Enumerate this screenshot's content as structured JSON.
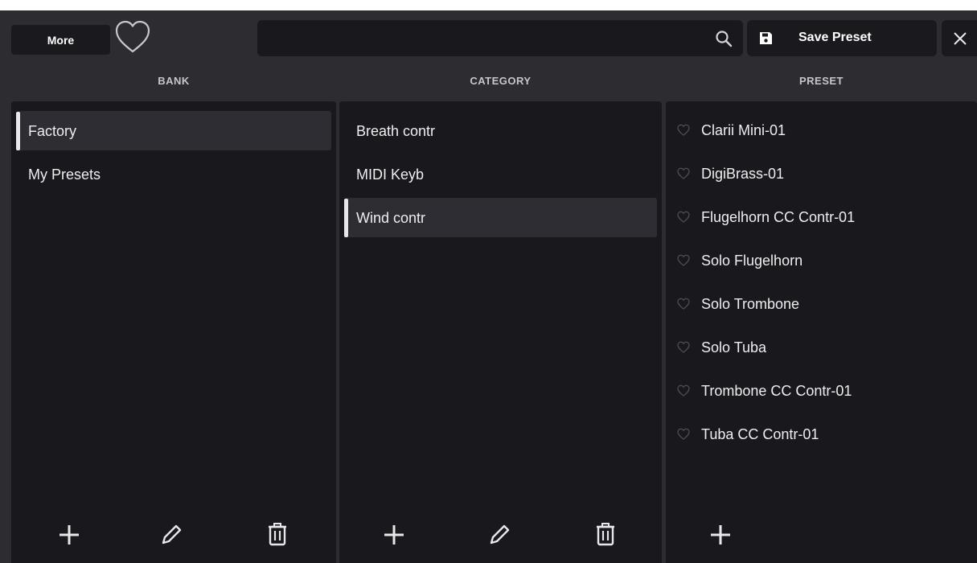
{
  "topbar": {
    "more_label": "More",
    "search_value": "",
    "search_placeholder": "",
    "save_label": "Save Preset"
  },
  "headers": {
    "bank": "BANK",
    "category": "CATEGORY",
    "preset": "PRESET"
  },
  "bank": {
    "items": [
      {
        "label": "Factory",
        "selected": true
      },
      {
        "label": "My Presets",
        "selected": false
      }
    ]
  },
  "category": {
    "items": [
      {
        "label": "Breath contr",
        "selected": false
      },
      {
        "label": "MIDI Keyb",
        "selected": false
      },
      {
        "label": "Wind contr",
        "selected": true
      }
    ]
  },
  "preset": {
    "items": [
      {
        "label": "Clarii Mini-01"
      },
      {
        "label": "DigiBrass-01"
      },
      {
        "label": "Flugelhorn CC Contr-01"
      },
      {
        "label": "Solo Flugelhorn"
      },
      {
        "label": "Solo Trombone"
      },
      {
        "label": "Solo Tuba"
      },
      {
        "label": "Trombone CC Contr-01"
      },
      {
        "label": "Tuba CC Contr-01"
      }
    ]
  },
  "icons": {
    "favorite": "heart-outline-icon",
    "search": "search-icon",
    "save": "floppy-disk-icon",
    "close": "close-icon",
    "add": "plus-icon",
    "edit": "pencil-icon",
    "delete": "trash-icon"
  },
  "colors": {
    "background": "#2d2c31",
    "panel": "#19181c",
    "selected_row": "#2e2d33",
    "text": "#eeeef0"
  }
}
